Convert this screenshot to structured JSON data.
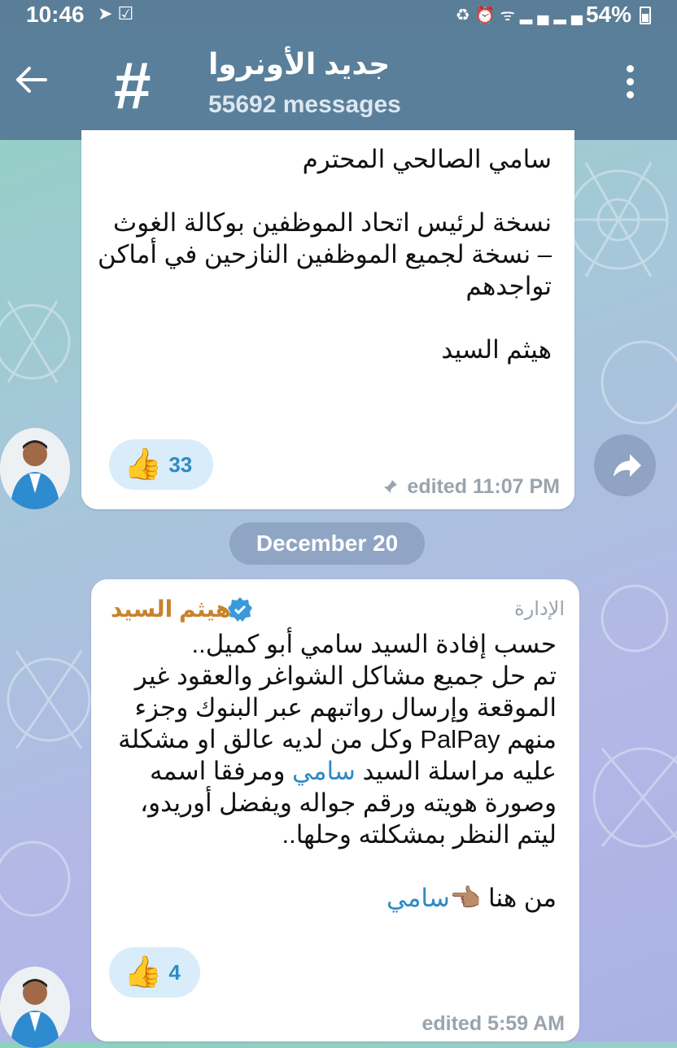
{
  "status_bar": {
    "time": "10:46",
    "battery": "54%",
    "icons": [
      "telegram-icon",
      "checkbox-icon",
      "recycle-icon",
      "alarm-icon",
      "wifi-icon",
      "signal-icon",
      "signal-icon",
      "battery-icon"
    ]
  },
  "header": {
    "title": "جديد الأونروا",
    "subtitle": "55692 messages",
    "channel_icon": "#"
  },
  "messages": [
    {
      "text": "سامي الصالحي المحترم\n\nنسخة لرئيس اتحاد الموظفين بوكالة الغوث\n– نسخة لجميع الموظفين النازحين في أماكن تواجدهم\n\nهيثم السيد",
      "reaction_emoji": "👍",
      "reaction_count": "33",
      "meta": "edited 11:07 PM",
      "pinned": true
    },
    {
      "sender": "هيثم السيد",
      "badge": "الإدارة",
      "text_before_link": "حسب إفادة السيد سامي أبو كميل..\nتم حل جميع مشاكل الشواغر والعقود غير الموقعة وإرسال رواتبهم عبر البنوك وجزء منهم PalPay وكل من لديه عالق او مشكلة عليه مراسلة السيد ",
      "link_1": "سامي",
      "text_after_link": " ومرفقا اسمه وصورة هويته ورقم جواله ويفضل أوريدو، ليتم النظر بمشكلته وحلها..\n\nمن هنا 👈🏽",
      "link_2": "سامي",
      "reaction_emoji": "👍",
      "reaction_count": "4",
      "meta": "edited 5:59 AM"
    }
  ],
  "date_separator": "December 20",
  "colors": {
    "header": "#5a7f9a",
    "sender": "#c8822e",
    "link": "#2f8bc4",
    "reaction_bg": "#d8edf9"
  }
}
